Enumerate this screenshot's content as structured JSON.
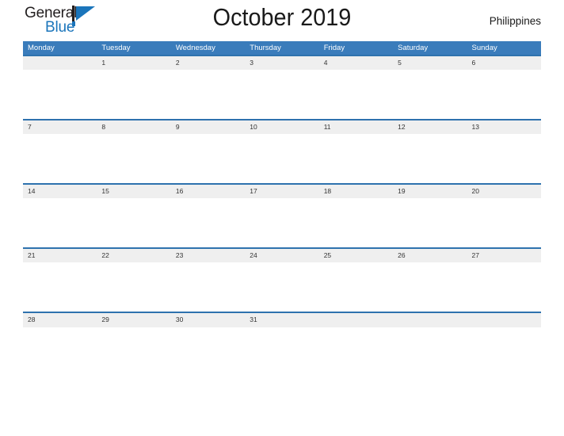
{
  "logo": {
    "text_primary": "General",
    "text_secondary": "Blue",
    "mark": "triangle-flag-mark",
    "color_primary": "#231f20",
    "color_secondary": "#1b75bb"
  },
  "header": {
    "title": "October 2019",
    "region": "Philippines"
  },
  "theme": {
    "header_blue": "#3a7cbb",
    "row_border_blue": "#2e72ae",
    "band_gray": "#efefef",
    "page_background": "#ffffff",
    "text_dark": "#1a1a1a"
  },
  "calendar": {
    "month": "October",
    "year": "2019",
    "first_day_of_week": "Monday",
    "weekdays": [
      "Monday",
      "Tuesday",
      "Wednesday",
      "Thursday",
      "Friday",
      "Saturday",
      "Sunday"
    ],
    "weeks": [
      [
        "",
        "1",
        "2",
        "3",
        "4",
        "5",
        "6"
      ],
      [
        "7",
        "8",
        "9",
        "10",
        "11",
        "12",
        "13"
      ],
      [
        "14",
        "15",
        "16",
        "17",
        "18",
        "19",
        "20"
      ],
      [
        "21",
        "22",
        "23",
        "24",
        "25",
        "26",
        "27"
      ],
      [
        "28",
        "29",
        "30",
        "31",
        "",
        "",
        ""
      ]
    ]
  }
}
